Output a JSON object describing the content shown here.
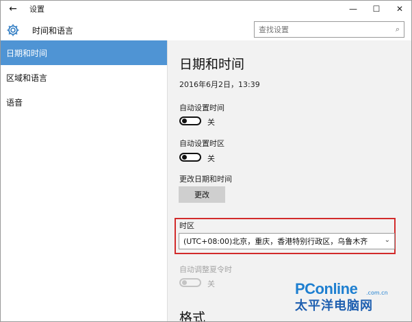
{
  "window": {
    "title": "设置",
    "back_glyph": "←",
    "controls": {
      "minimize": "—",
      "maximize": "☐",
      "close": "✕"
    }
  },
  "header": {
    "app_name": "时间和语言",
    "search_placeholder": "查找设置"
  },
  "sidebar": {
    "items": [
      {
        "label": "日期和时间",
        "active": true
      },
      {
        "label": "区域和语言",
        "active": false
      },
      {
        "label": "语音",
        "active": false
      }
    ]
  },
  "content": {
    "title": "日期和时间",
    "current_datetime": "2016年6月2日，13:39",
    "auto_time": {
      "label": "自动设置时间",
      "state": "关"
    },
    "auto_timezone": {
      "label": "自动设置时区",
      "state": "关"
    },
    "change_datetime": {
      "label": "更改日期和时间",
      "button": "更改"
    },
    "timezone": {
      "label": "时区",
      "value": "(UTC+08:00)北京，重庆，香港特别行政区，乌鲁木齐"
    },
    "dst": {
      "label": "自动调整夏令时",
      "state": "关",
      "disabled": true
    },
    "format_title": "格式"
  },
  "watermark": {
    "line1": "PConline",
    "suffix": ".com.cn",
    "line2": "太平洋电脑网"
  },
  "colors": {
    "accent": "#4f94d4",
    "highlight_border": "#d22a2a",
    "content_bg": "#f2f2f2",
    "watermark": "#1e7fd0"
  }
}
